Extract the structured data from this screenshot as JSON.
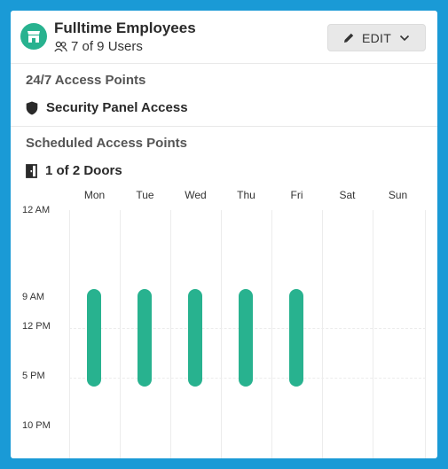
{
  "group": {
    "name": "Fulltime Employees",
    "users_text": "7 of 9 Users",
    "edit_label": "EDIT"
  },
  "always_access": {
    "title": "24/7 Access Points",
    "items": [
      {
        "label": "Security Panel Access",
        "icon": "shield-icon"
      }
    ]
  },
  "scheduled_access": {
    "title": "Scheduled Access Points",
    "doors_text": "1 of 2 Doors",
    "days": [
      "Mon",
      "Tue",
      "Wed",
      "Thu",
      "Fri",
      "Sat",
      "Sun"
    ],
    "time_labels": [
      "12 AM",
      "9 AM",
      "12 PM",
      "5 PM",
      "10 PM"
    ],
    "schedule": [
      {
        "day": "Mon",
        "start": "9 AM",
        "end": "5 PM"
      },
      {
        "day": "Tue",
        "start": "9 AM",
        "end": "5 PM"
      },
      {
        "day": "Wed",
        "start": "9 AM",
        "end": "5 PM"
      },
      {
        "day": "Thu",
        "start": "9 AM",
        "end": "5 PM"
      },
      {
        "day": "Fri",
        "start": "9 AM",
        "end": "5 PM"
      }
    ]
  },
  "colors": {
    "accent": "#28b28f",
    "background": "#1a9ad6"
  }
}
